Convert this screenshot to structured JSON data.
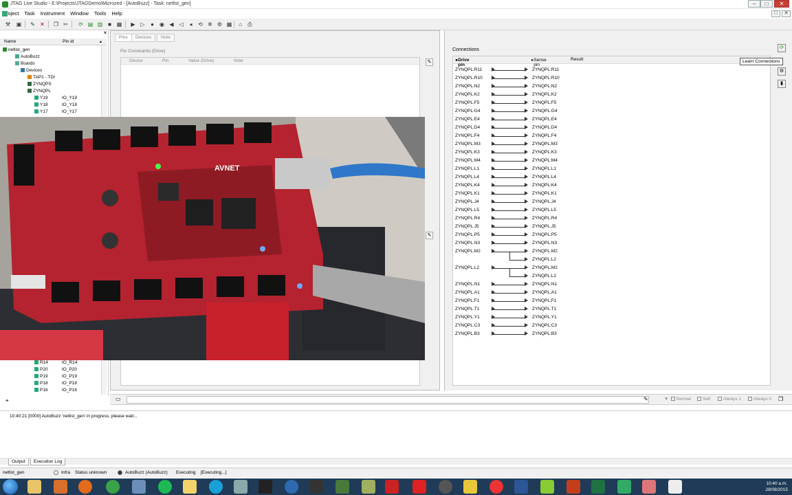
{
  "window": {
    "title": "JTAG Live Studio - E:\\Projects\\JTAGDemo\\Microzed - [AutoBuzz] - Task: netlist_gen]",
    "minimize": "–",
    "maximize": "□",
    "close": "✕"
  },
  "menu": [
    "Project",
    "Task",
    "Instrument",
    "Window",
    "Tools",
    "Help"
  ],
  "tree": {
    "headers": {
      "name": "Name",
      "pin_id": "Pin id"
    },
    "rows_top": [
      {
        "label": "netlist_gen",
        "pin": ""
      },
      {
        "label": "AutoBuzz",
        "pin": ""
      },
      {
        "label": "Boards",
        "pin": ""
      },
      {
        "label": "Devices",
        "pin": ""
      },
      {
        "label": "TAP1 - TDI",
        "pin": ""
      },
      {
        "label": "ZYNQPS",
        "pin": ""
      },
      {
        "label": "ZYNQPL",
        "pin": ""
      },
      {
        "label": "Y19",
        "pin": "IO_Y19"
      },
      {
        "label": "Y18",
        "pin": "IO_Y18"
      },
      {
        "label": "Y17",
        "pin": "IO_Y17"
      }
    ],
    "rows_bottom": [
      {
        "label": "R14",
        "pin": "IO_R14"
      },
      {
        "label": "P20",
        "pin": "IO_P20"
      },
      {
        "label": "P19",
        "pin": "IO_P19"
      },
      {
        "label": "P18",
        "pin": "IO_P18"
      },
      {
        "label": "P16",
        "pin": "IO_P16"
      }
    ]
  },
  "middle": {
    "tabs": [
      "Pins",
      "Devices",
      "Note"
    ],
    "section_label": "Pin Constraints (Drive)",
    "columns": [
      "Device",
      "Pin",
      "Value (Drive)",
      "Note"
    ]
  },
  "connections": {
    "label": "Connections",
    "columns": {
      "drive": "Drive pin",
      "sense": "Sense pin",
      "result": "Result"
    },
    "tooltip": "Learn Connections",
    "rows": [
      {
        "drive": "ZYNQPL.R11",
        "sense": "ZYNQPL.R11"
      },
      {
        "drive": "ZYNQPL.R10",
        "sense": "ZYNQPL.R10"
      },
      {
        "drive": "ZYNQPL.N2",
        "sense": "ZYNQPL.N2"
      },
      {
        "drive": "ZYNQPL.K2",
        "sense": "ZYNQPL.K2"
      },
      {
        "drive": "ZYNQPL.F5",
        "sense": "ZYNQPL.F5"
      },
      {
        "drive": "ZYNQPL.G4",
        "sense": "ZYNQPL.G4"
      },
      {
        "drive": "ZYNQPL.E4",
        "sense": "ZYNQPL.E4"
      },
      {
        "drive": "ZYNQPL.D4",
        "sense": "ZYNQPL.D4"
      },
      {
        "drive": "ZYNQPL.F4",
        "sense": "ZYNQPL.F4"
      },
      {
        "drive": "ZYNQPL.M3",
        "sense": "ZYNQPL.M3"
      },
      {
        "drive": "ZYNQPL.K3",
        "sense": "ZYNQPL.K3"
      },
      {
        "drive": "ZYNQPL.M4",
        "sense": "ZYNQPL.M4"
      },
      {
        "drive": "ZYNQPL.L1",
        "sense": "ZYNQPL.L1"
      },
      {
        "drive": "ZYNQPL.L4",
        "sense": "ZYNQPL.L4"
      },
      {
        "drive": "ZYNQPL.K4",
        "sense": "ZYNQPL.K4"
      },
      {
        "drive": "ZYNQPL.K1",
        "sense": "ZYNQPL.K1"
      },
      {
        "drive": "ZYNQPL.J4",
        "sense": "ZYNQPL.J4"
      },
      {
        "drive": "ZYNQPL.L5",
        "sense": "ZYNQPL.L5"
      },
      {
        "drive": "ZYNQPL.R4",
        "sense": "ZYNQPL.R4"
      },
      {
        "drive": "ZYNQPL.J5",
        "sense": "ZYNQPL.J5"
      },
      {
        "drive": "ZYNQPL.P5",
        "sense": "ZYNQPL.P5"
      },
      {
        "drive": "ZYNQPL.N3",
        "sense": "ZYNQPL.N3"
      },
      {
        "drive": "ZYNQPL.M2",
        "sense": "ZYNQPL.M2"
      },
      {
        "drive": "",
        "sense": "ZYNQPL.L2"
      },
      {
        "drive": "ZYNQPL.L2",
        "sense": "ZYNQPL.M2"
      },
      {
        "drive": "",
        "sense": "ZYNQPL.L2"
      },
      {
        "drive": "ZYNQPL.N1",
        "sense": "ZYNQPL.N1"
      },
      {
        "drive": "ZYNQPL.A1",
        "sense": "ZYNQPL.A1"
      },
      {
        "drive": "ZYNQPL.F1",
        "sense": "ZYNQPL.F1"
      },
      {
        "drive": "ZYNQPL.T1",
        "sense": "ZYNQPL.T1"
      },
      {
        "drive": "ZYNQPL.Y1",
        "sense": "ZYNQPL.Y1"
      },
      {
        "drive": "ZYNQPL.C3",
        "sense": "ZYNQPL.C3"
      },
      {
        "drive": "ZYNQPL.B3",
        "sense": "ZYNQPL.B3"
      }
    ]
  },
  "filterbar": {
    "normal": "Normal",
    "self": "Self",
    "always1": "Always 1",
    "always0": "Always 0"
  },
  "output": {
    "line": "10:40:21 [0000] AutoBuzz 'netlist_gen' in progress, please wait...",
    "tabs": [
      "Output",
      "Execution Log"
    ]
  },
  "status": {
    "task": "netlist_gen",
    "infra_label": "Infra",
    "infra_status": "Status unknown",
    "autobuzz": "AutoBuzz (AutoBuzz)",
    "executing": "Executing",
    "executing2": "[Executing...]"
  },
  "clock": {
    "time": "10:40 a.m.",
    "date": "28/08/2015"
  },
  "photo": {
    "board_text": "AVNET"
  }
}
